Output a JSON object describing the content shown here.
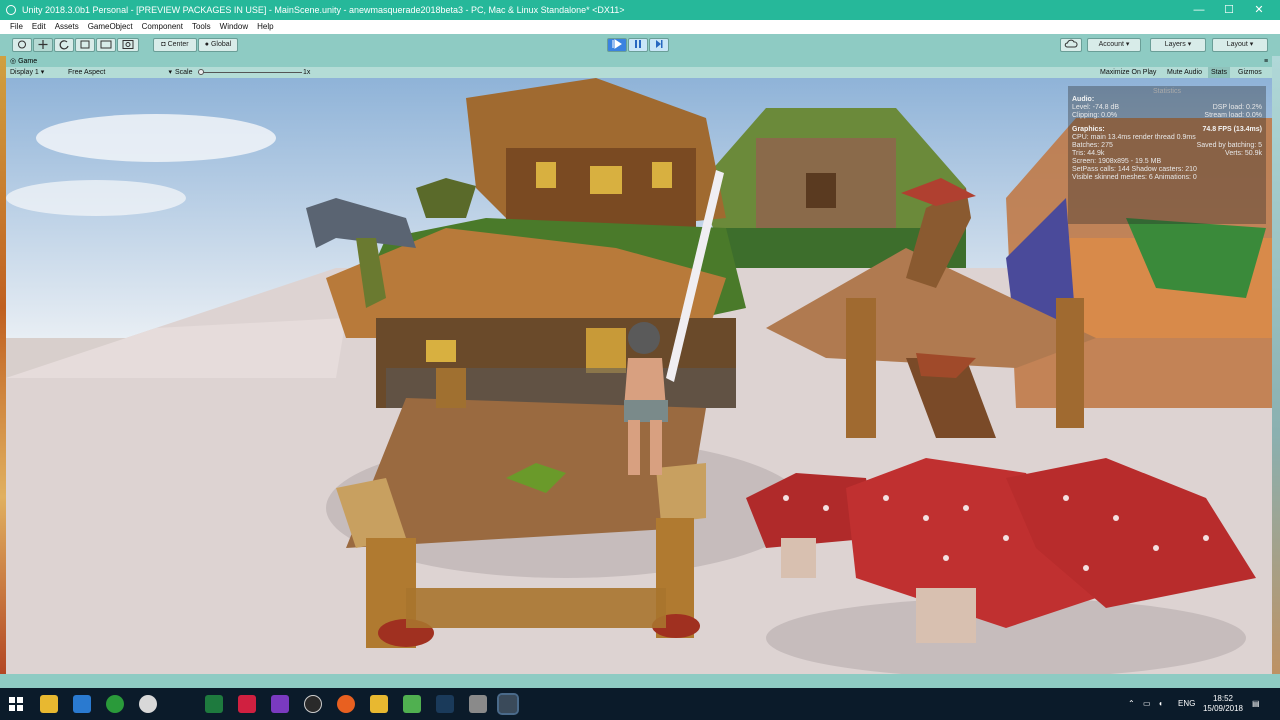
{
  "window": {
    "title": "Unity 2018.3.0b1 Personal - [PREVIEW PACKAGES IN USE] - MainScene.unity - anewmasquerade2018beta3 - PC, Mac & Linux Standalone* <DX11>",
    "minimize": "—",
    "maximize": "☐",
    "close": "✕"
  },
  "menu": [
    "File",
    "Edit",
    "Assets",
    "GameObject",
    "Component",
    "Tools",
    "Window",
    "Help"
  ],
  "toolbar": {
    "tools": [
      "hand-tool",
      "move-tool",
      "rotate-tool",
      "scale-tool",
      "rect-tool",
      "transform-tool"
    ],
    "pivot_label": "Center",
    "space_label": "Global",
    "account_label": "Account",
    "layers_label": "Layers",
    "layout_label": "Layout",
    "cloud_icon": "cloud-icon"
  },
  "game_tab": {
    "label": "Game",
    "display": "Display 1",
    "aspect": "Free Aspect",
    "scale_label": "Scale",
    "scale_value": "1x",
    "maximize_on_play": "Maximize On Play",
    "mute_audio": "Mute Audio",
    "stats": "Stats",
    "gizmos": "Gizmos"
  },
  "stats_panel": {
    "title": "Statistics",
    "audio_header": "Audio:",
    "level": "Level: -74.8 dB",
    "dsp_load": "DSP load: 0.2%",
    "clipping": "Clipping: 0.0%",
    "stream_load": "Stream load: 0.0%",
    "graphics_header": "Graphics:",
    "fps": "74.8 FPS (13.4ms)",
    "cpu": "CPU: main 13.4ms  render thread 0.9ms",
    "batches": "Batches: 275",
    "saved_batching": "Saved by batching: 5",
    "tris": "Tris: 44.9k",
    "verts": "Verts: 50.9k",
    "screen": "Screen: 1908x895 - 19.5 MB",
    "setpass": "SetPass calls: 144   Shadow casters: 210",
    "skinned": "Visible skinned meshes: 6  Animations: 0"
  },
  "taskbar": {
    "lang": "ENG",
    "time": "18:52",
    "date": "15/09/2018",
    "apps": [
      "start-icon",
      "file-explorer-icon",
      "desktop-icon",
      "xbox-icon",
      "browser-icon",
      "excel-icon",
      "media-icon",
      "visual-studio-icon",
      "unity-hub-icon",
      "firefox-icon",
      "folder-icon",
      "notepad-icon",
      "steam-icon",
      "photos-icon",
      "unity-icon"
    ]
  },
  "colors": {
    "title_bar": "#26b89a",
    "toolbar": "#8ecbc3",
    "play_active": "#3b82e0",
    "taskbar": "#0b1b2a"
  }
}
